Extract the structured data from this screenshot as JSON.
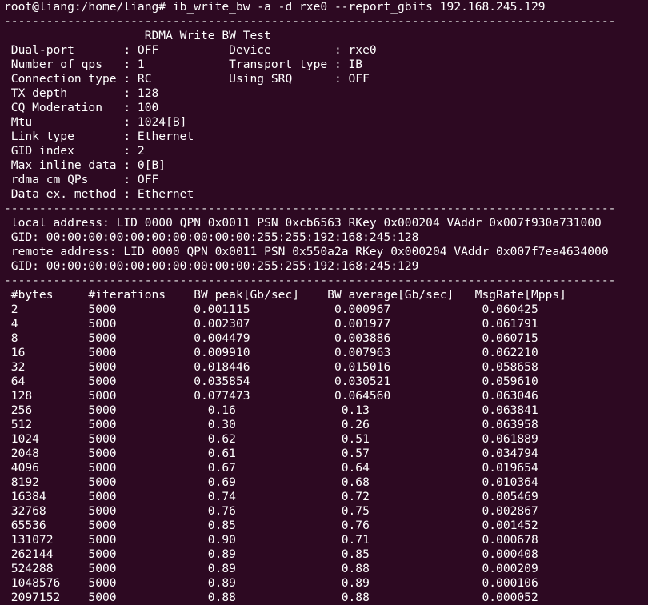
{
  "colors": {
    "background": "#2d0922",
    "text": "#ffffff"
  },
  "terminal": {
    "lines": [
      "root@liang:/home/liang# ib_write_bw -a -d rxe0 --report_gbits 192.168.245.129",
      "---------------------------------------------------------------------------------------",
      "                    RDMA_Write BW Test",
      " Dual-port       : OFF          Device         : rxe0",
      " Number of qps   : 1            Transport type : IB",
      " Connection type : RC           Using SRQ      : OFF",
      " TX depth        : 128",
      " CQ Moderation   : 100",
      " Mtu             : 1024[B]",
      " Link type       : Ethernet",
      " GID index       : 2",
      " Max inline data : 0[B]",
      " rdma_cm QPs     : OFF",
      " Data ex. method : Ethernet",
      "---------------------------------------------------------------------------------------",
      " local address: LID 0000 QPN 0x0011 PSN 0xcb6563 RKey 0x000204 VAddr 0x007f930a731000",
      " GID: 00:00:00:00:00:00:00:00:00:00:255:255:192:168:245:128",
      " remote address: LID 0000 QPN 0x0011 PSN 0x550a2a RKey 0x000204 VAddr 0x007f7ea4634000",
      " GID: 00:00:00:00:00:00:00:00:00:00:255:255:192:168:245:129",
      "---------------------------------------------------------------------------------------",
      " #bytes     #iterations    BW peak[Gb/sec]    BW average[Gb/sec]   MsgRate[Mpps]",
      " 2          5000           0.001115            0.000967             0.060425",
      " 4          5000           0.002307            0.001977             0.061791",
      " 8          5000           0.004479            0.003886             0.060715",
      " 16         5000           0.009910            0.007963             0.062210",
      " 32         5000           0.018446            0.015016             0.058658",
      " 64         5000           0.035854            0.030521             0.059610",
      " 128        5000           0.077473            0.064560             0.063046",
      " 256        5000             0.16               0.13                0.063841",
      " 512        5000             0.30               0.26                0.063958",
      " 1024       5000             0.62               0.51                0.061889",
      " 2048       5000             0.61               0.57                0.034794",
      " 4096       5000             0.67               0.64                0.019654",
      " 8192       5000             0.69               0.68                0.010364",
      " 16384      5000             0.74               0.72                0.005469",
      " 32768      5000             0.76               0.75                0.002867",
      " 65536      5000             0.85               0.76                0.001452",
      " 131072     5000             0.90               0.71                0.000678",
      " 262144     5000             0.89               0.85                0.000408",
      " 524288     5000             0.89               0.88                0.000209",
      " 1048576    5000             0.89               0.89                0.000106",
      " 2097152    5000             0.88               0.88                0.000052"
    ]
  }
}
